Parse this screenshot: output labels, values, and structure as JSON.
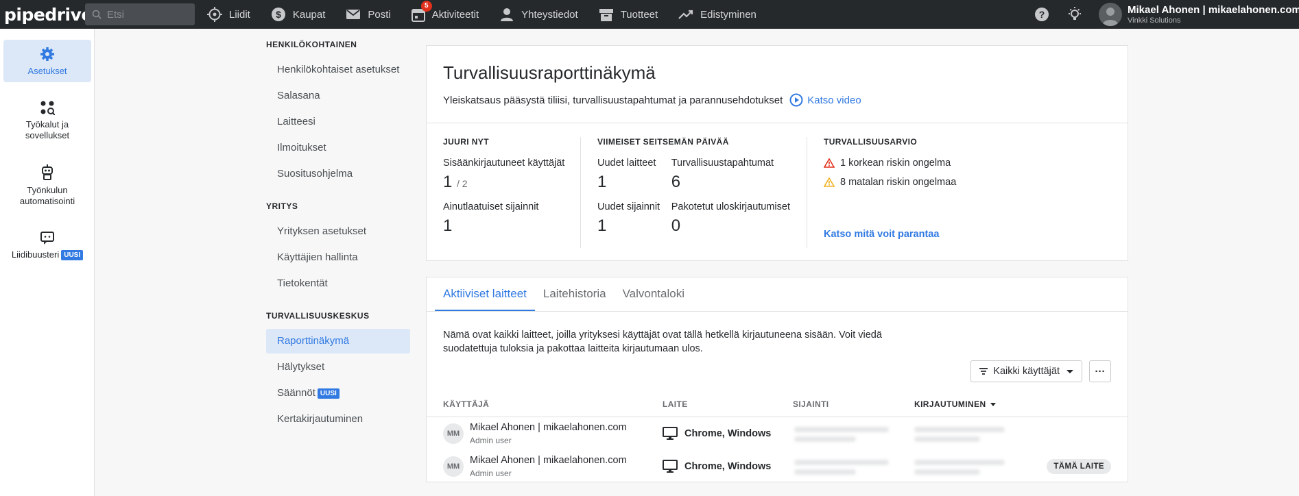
{
  "topbar": {
    "logo": "pipedrive",
    "search_placeholder": "Etsi",
    "nav": [
      {
        "label": "Liidit",
        "icon": "target-icon"
      },
      {
        "label": "Kaupat",
        "icon": "dollar-icon"
      },
      {
        "label": "Posti",
        "icon": "mail-icon"
      },
      {
        "label": "Aktiviteetit",
        "icon": "calendar-icon",
        "badge": "5"
      },
      {
        "label": "Yhteystiedot",
        "icon": "person-icon"
      },
      {
        "label": "Tuotteet",
        "icon": "box-icon"
      },
      {
        "label": "Edistyminen",
        "icon": "trend-icon"
      }
    ],
    "user_name": "Mikael Ahonen | mikaelahonen.com",
    "user_company": "Vinkki Solutions"
  },
  "rail": {
    "items": [
      {
        "label": "Asetukset",
        "icon": "gear-icon",
        "active": true
      },
      {
        "label": "Työkalut ja sovellukset",
        "icon": "tools-icon"
      },
      {
        "label": "Työnkulun automatisointi",
        "icon": "robot-icon"
      },
      {
        "label": "Liidibuusteri",
        "icon": "chat-icon",
        "badge": "UUSI"
      }
    ]
  },
  "menu": {
    "sections": [
      {
        "title": "HENKILÖKOHTAINEN",
        "items": [
          "Henkilökohtaiset asetukset",
          "Salasana",
          "Laitteesi",
          "Ilmoitukset",
          "Suositusohjelma"
        ]
      },
      {
        "title": "YRITYS",
        "items": [
          "Yrityksen asetukset",
          "Käyttäjien hallinta",
          "Tietokentät"
        ]
      },
      {
        "title": "TURVALLISUUSKESKUS",
        "items": [
          "Raporttinäkymä",
          "Hälytykset",
          "Säännöt",
          "Kertakirjautuminen"
        ]
      }
    ],
    "active_item": "Raporttinäkymä",
    "new_badge": "UUSI"
  },
  "hero": {
    "title": "Turvallisuusraporttinäkymä",
    "subtitle": "Yleiskatsaus pääsystä tiliisi, turvallisuustapahtumat ja parannusehdotukset",
    "video_link": "Katso video",
    "now": {
      "heading": "JUURI NYT",
      "logged_in_label": "Sisäänkirjautuneet käyttäjät",
      "logged_in_value": "1",
      "logged_in_total": "/ 2",
      "locations_label": "Ainutlaatuiset sijainnit",
      "locations_value": "1"
    },
    "week": {
      "heading": "VIIMEISET SEITSEMÄN PÄIVÄÄ",
      "new_devices_label": "Uudet laitteet",
      "new_devices_value": "1",
      "events_label": "Turvallisuustapahtumat",
      "events_value": "6",
      "new_locations_label": "Uudet sijainnit",
      "new_locations_value": "1",
      "forced_logouts_label": "Pakotetut uloskirjautumiset",
      "forced_logouts_value": "0"
    },
    "rating": {
      "heading": "TURVALLISUUSARVIO",
      "high_risk": "1 korkean riskin ongelma",
      "low_risk": "8 matalan riskin ongelmaa",
      "improve_link": "Katso mitä voit parantaa"
    }
  },
  "devices": {
    "tabs": [
      "Aktiiviset laitteet",
      "Laitehistoria",
      "Valvontaloki"
    ],
    "active_tab": "Aktiiviset laitteet",
    "description": "Nämä ovat kaikki laitteet, joilla yrityksesi käyttäjät ovat tällä hetkellä kirjautuneena sisään. Voit viedä suodatettuja tuloksia ja pakottaa laitteita kirjautumaan ulos.",
    "filter_label": "Kaikki käyttäjät",
    "more_label": "···",
    "columns": [
      "KÄYTTÄJÄ",
      "LAITE",
      "SIJAINTI",
      "KIRJAUTUMINEN"
    ],
    "rows": [
      {
        "initials": "MM",
        "name": "Mikael Ahonen | mikaelahonen.com",
        "role": "Admin user",
        "device": "Chrome, Windows",
        "tag": ""
      },
      {
        "initials": "MM",
        "name": "Mikael Ahonen | mikaelahonen.com",
        "role": "Admin user",
        "device": "Chrome, Windows",
        "tag": "TÄMÄ LAITE"
      }
    ]
  },
  "colors": {
    "accent": "#317ae2",
    "topbar": "#26292c",
    "danger": "#e0311c",
    "warning": "#f2b01e"
  }
}
